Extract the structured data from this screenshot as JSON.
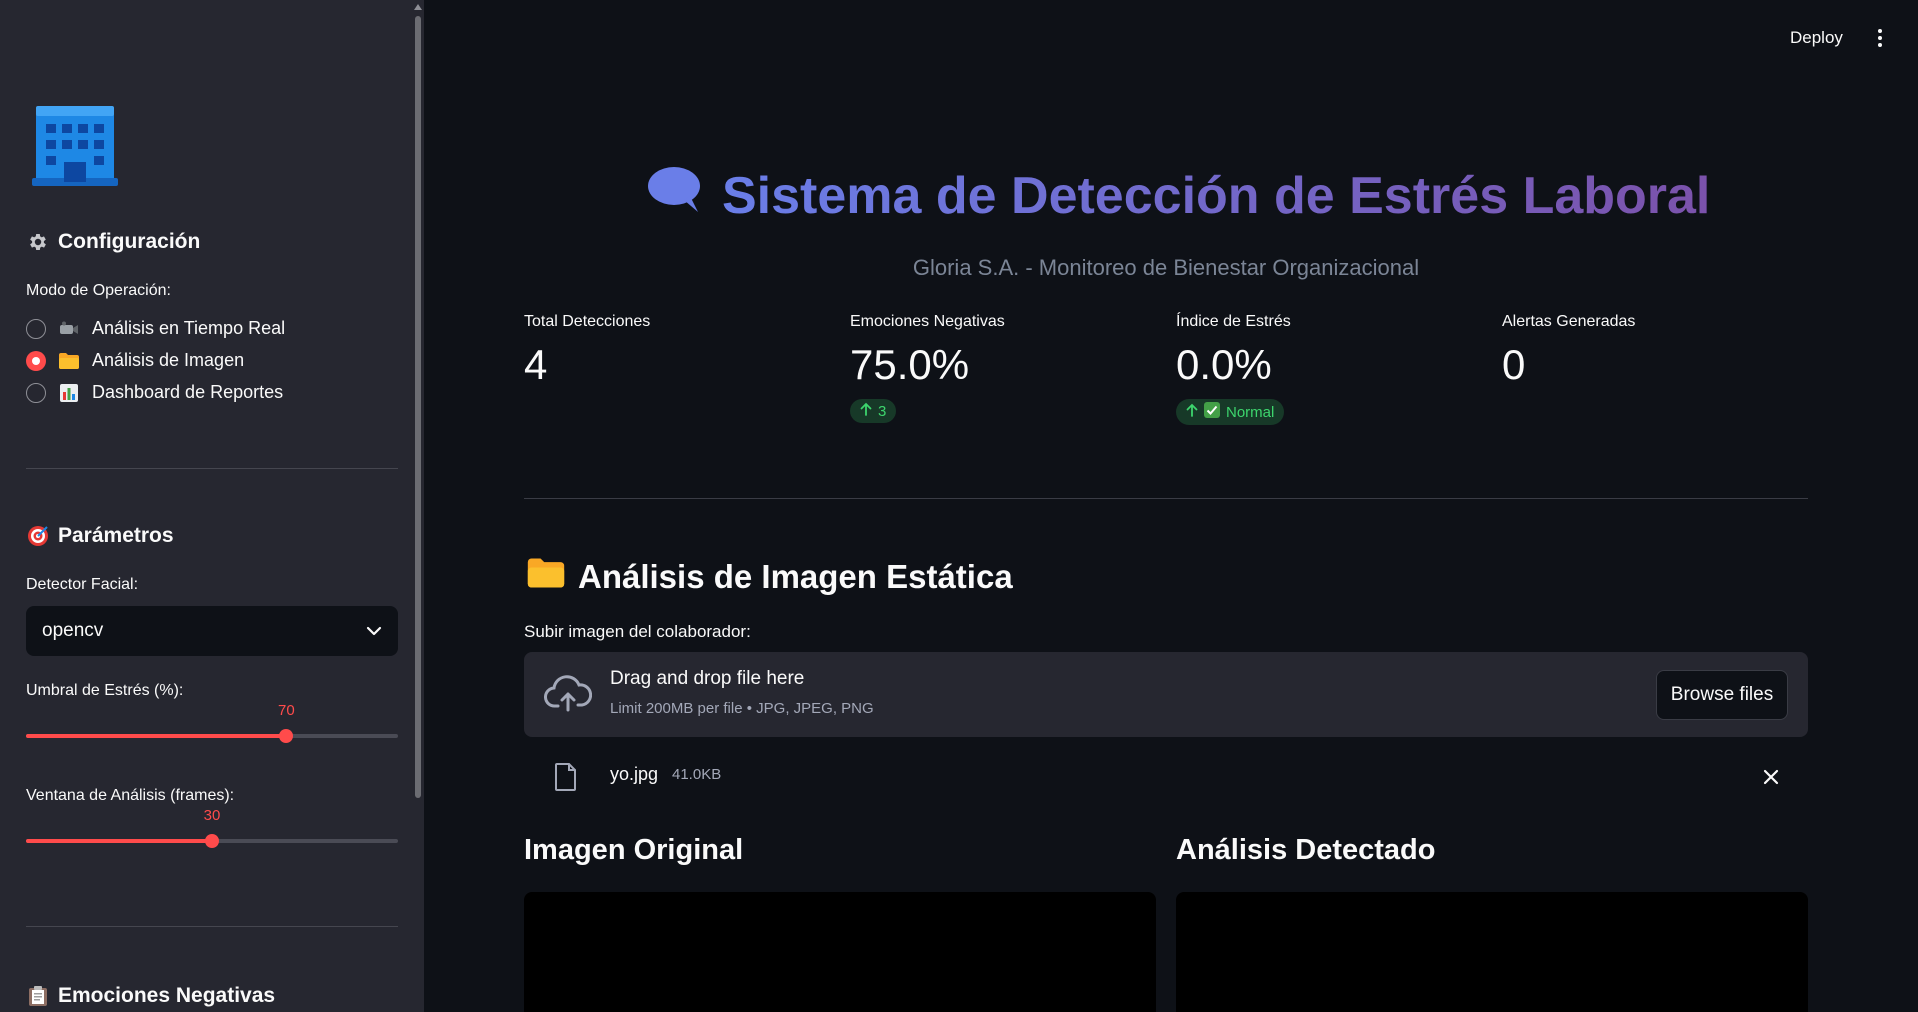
{
  "sidebar": {
    "config_heading": "Configuración",
    "mode_label": "Modo de Operación:",
    "modes": [
      {
        "icon": "video-camera-icon",
        "label": "Análisis en Tiempo Real",
        "selected": false
      },
      {
        "icon": "folder-icon",
        "label": "Análisis de Imagen",
        "selected": true
      },
      {
        "icon": "bar-chart-icon",
        "label": "Dashboard de Reportes",
        "selected": false
      }
    ],
    "params_heading": "Parámetros",
    "detector_label": "Detector Facial:",
    "detector_value": "opencv",
    "stress_threshold": {
      "label": "Umbral de Estrés (%):",
      "value": "70",
      "min": 0,
      "max": 100
    },
    "window": {
      "label": "Ventana de Análisis (frames):",
      "value": "30",
      "min": 10,
      "max": 50
    },
    "negatives_heading": "Emociones Negativas"
  },
  "header": {
    "deploy_label": "Deploy"
  },
  "main": {
    "title": "Sistema de Detección de Estrés Laboral",
    "subtitle": "Gloria S.A. - Monitoreo de Bienestar Organizacional",
    "metrics": [
      {
        "label": "Total Detecciones",
        "value": "4",
        "delta": ""
      },
      {
        "label": "Emociones Negativas",
        "value": "75.0%",
        "delta": "3"
      },
      {
        "label": "Índice de Estrés",
        "value": "0.0%",
        "delta": "Normal"
      },
      {
        "label": "Alertas Generadas",
        "value": "0",
        "delta": ""
      }
    ],
    "section_title": "Análisis de Imagen Estática",
    "upload_label": "Subir imagen del colaborador:",
    "dropzone_main": "Drag and drop file here",
    "dropzone_sub": "Limit 200MB per file • JPG, JPEG, PNG",
    "browse_label": "Browse files",
    "file_name": "yo.jpg",
    "file_size": "41.0KB",
    "col_original": "Imagen Original",
    "col_analysis": "Análisis Detectado"
  },
  "colors": {
    "accent": "#ff4b4b",
    "sidebar_bg": "#262730",
    "main_bg": "#0e1117",
    "positive_delta": "#3dd56d"
  }
}
